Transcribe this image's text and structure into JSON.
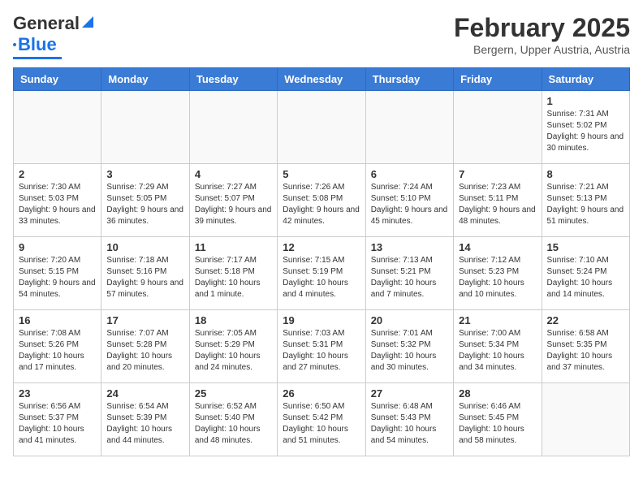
{
  "header": {
    "logo": {
      "part1": "General",
      "part2": "Blue"
    },
    "title": "February 2025",
    "subtitle": "Bergern, Upper Austria, Austria"
  },
  "calendar": {
    "days_of_week": [
      "Sunday",
      "Monday",
      "Tuesday",
      "Wednesday",
      "Thursday",
      "Friday",
      "Saturday"
    ],
    "weeks": [
      {
        "days": [
          {
            "num": "",
            "info": ""
          },
          {
            "num": "",
            "info": ""
          },
          {
            "num": "",
            "info": ""
          },
          {
            "num": "",
            "info": ""
          },
          {
            "num": "",
            "info": ""
          },
          {
            "num": "",
            "info": ""
          },
          {
            "num": "1",
            "info": "Sunrise: 7:31 AM\nSunset: 5:02 PM\nDaylight: 9 hours and 30 minutes."
          }
        ]
      },
      {
        "days": [
          {
            "num": "2",
            "info": "Sunrise: 7:30 AM\nSunset: 5:03 PM\nDaylight: 9 hours and 33 minutes."
          },
          {
            "num": "3",
            "info": "Sunrise: 7:29 AM\nSunset: 5:05 PM\nDaylight: 9 hours and 36 minutes."
          },
          {
            "num": "4",
            "info": "Sunrise: 7:27 AM\nSunset: 5:07 PM\nDaylight: 9 hours and 39 minutes."
          },
          {
            "num": "5",
            "info": "Sunrise: 7:26 AM\nSunset: 5:08 PM\nDaylight: 9 hours and 42 minutes."
          },
          {
            "num": "6",
            "info": "Sunrise: 7:24 AM\nSunset: 5:10 PM\nDaylight: 9 hours and 45 minutes."
          },
          {
            "num": "7",
            "info": "Sunrise: 7:23 AM\nSunset: 5:11 PM\nDaylight: 9 hours and 48 minutes."
          },
          {
            "num": "8",
            "info": "Sunrise: 7:21 AM\nSunset: 5:13 PM\nDaylight: 9 hours and 51 minutes."
          }
        ]
      },
      {
        "days": [
          {
            "num": "9",
            "info": "Sunrise: 7:20 AM\nSunset: 5:15 PM\nDaylight: 9 hours and 54 minutes."
          },
          {
            "num": "10",
            "info": "Sunrise: 7:18 AM\nSunset: 5:16 PM\nDaylight: 9 hours and 57 minutes."
          },
          {
            "num": "11",
            "info": "Sunrise: 7:17 AM\nSunset: 5:18 PM\nDaylight: 10 hours and 1 minute."
          },
          {
            "num": "12",
            "info": "Sunrise: 7:15 AM\nSunset: 5:19 PM\nDaylight: 10 hours and 4 minutes."
          },
          {
            "num": "13",
            "info": "Sunrise: 7:13 AM\nSunset: 5:21 PM\nDaylight: 10 hours and 7 minutes."
          },
          {
            "num": "14",
            "info": "Sunrise: 7:12 AM\nSunset: 5:23 PM\nDaylight: 10 hours and 10 minutes."
          },
          {
            "num": "15",
            "info": "Sunrise: 7:10 AM\nSunset: 5:24 PM\nDaylight: 10 hours and 14 minutes."
          }
        ]
      },
      {
        "days": [
          {
            "num": "16",
            "info": "Sunrise: 7:08 AM\nSunset: 5:26 PM\nDaylight: 10 hours and 17 minutes."
          },
          {
            "num": "17",
            "info": "Sunrise: 7:07 AM\nSunset: 5:28 PM\nDaylight: 10 hours and 20 minutes."
          },
          {
            "num": "18",
            "info": "Sunrise: 7:05 AM\nSunset: 5:29 PM\nDaylight: 10 hours and 24 minutes."
          },
          {
            "num": "19",
            "info": "Sunrise: 7:03 AM\nSunset: 5:31 PM\nDaylight: 10 hours and 27 minutes."
          },
          {
            "num": "20",
            "info": "Sunrise: 7:01 AM\nSunset: 5:32 PM\nDaylight: 10 hours and 30 minutes."
          },
          {
            "num": "21",
            "info": "Sunrise: 7:00 AM\nSunset: 5:34 PM\nDaylight: 10 hours and 34 minutes."
          },
          {
            "num": "22",
            "info": "Sunrise: 6:58 AM\nSunset: 5:35 PM\nDaylight: 10 hours and 37 minutes."
          }
        ]
      },
      {
        "days": [
          {
            "num": "23",
            "info": "Sunrise: 6:56 AM\nSunset: 5:37 PM\nDaylight: 10 hours and 41 minutes."
          },
          {
            "num": "24",
            "info": "Sunrise: 6:54 AM\nSunset: 5:39 PM\nDaylight: 10 hours and 44 minutes."
          },
          {
            "num": "25",
            "info": "Sunrise: 6:52 AM\nSunset: 5:40 PM\nDaylight: 10 hours and 48 minutes."
          },
          {
            "num": "26",
            "info": "Sunrise: 6:50 AM\nSunset: 5:42 PM\nDaylight: 10 hours and 51 minutes."
          },
          {
            "num": "27",
            "info": "Sunrise: 6:48 AM\nSunset: 5:43 PM\nDaylight: 10 hours and 54 minutes."
          },
          {
            "num": "28",
            "info": "Sunrise: 6:46 AM\nSunset: 5:45 PM\nDaylight: 10 hours and 58 minutes."
          },
          {
            "num": "",
            "info": ""
          }
        ]
      }
    ]
  }
}
